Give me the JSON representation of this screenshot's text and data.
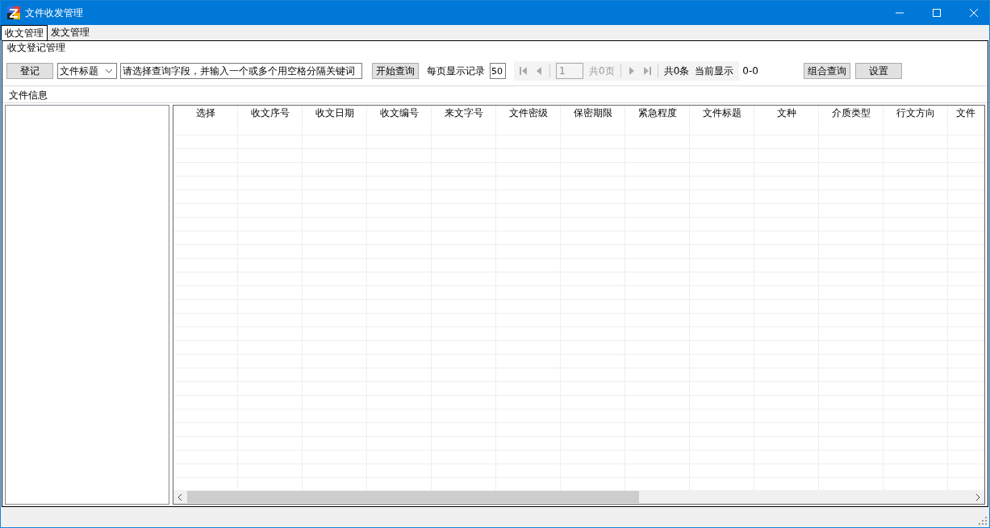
{
  "window": {
    "title": "文件收发管理"
  },
  "tabs": [
    {
      "label": "收文管理",
      "selected": true
    },
    {
      "label": "发文管理",
      "selected": false
    }
  ],
  "register_group": {
    "title": "收文登记管理"
  },
  "toolbar": {
    "register_button": "登记",
    "field_select": "文件标题",
    "search": {
      "placeholder": "请选择查询字段，并输入一个或多个用空格分隔关键词"
    },
    "query_button": "开始查询",
    "per_page_label": "每页显示记录",
    "per_page": "50",
    "page_input": "1",
    "page_total": "共0页",
    "record_total": "共0条",
    "current_label": "当前显示",
    "current_range": "0-0",
    "combined_query_button": "组合查询",
    "settings_button": "设置"
  },
  "info_group": {
    "title": "文件信息"
  },
  "table": {
    "columns": [
      "选择",
      "收文序号",
      "收文日期",
      "收文编号",
      "来文字号",
      "文件密级",
      "保密期限",
      "紧急程度",
      "文件标题",
      "文种",
      "介质类型",
      "行文方向",
      "文件"
    ]
  }
}
